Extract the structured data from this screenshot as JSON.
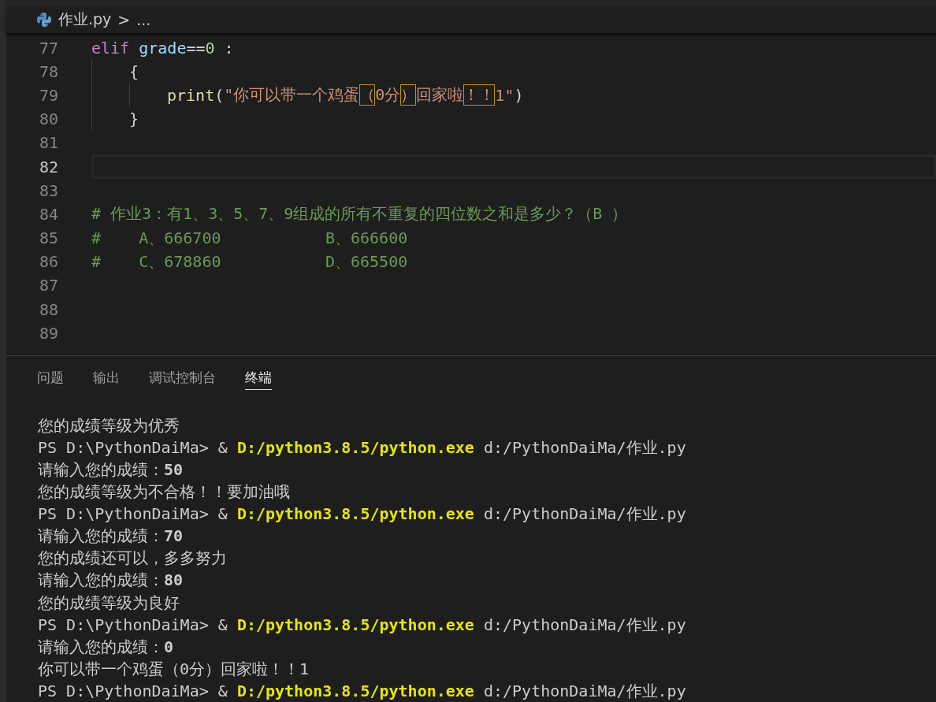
{
  "breadcrumb": {
    "file": "作业.py",
    "separator": ">",
    "more": "..."
  },
  "editor": {
    "lines": [
      {
        "number": "77",
        "current": false,
        "tokens": [
          {
            "kind": "keyword",
            "text": "elif"
          },
          {
            "kind": "variable",
            "text": " grade"
          },
          {
            "kind": "plain",
            "text": "=="
          },
          {
            "kind": "number",
            "text": "0"
          },
          {
            "kind": "plain",
            "text": " :"
          }
        ]
      },
      {
        "number": "78",
        "current": false,
        "tokens": [
          {
            "kind": "indent"
          },
          {
            "kind": "plain",
            "text": "{"
          }
        ]
      },
      {
        "number": "79",
        "current": false,
        "tokens": [
          {
            "kind": "indent"
          },
          {
            "kind": "indent"
          },
          {
            "kind": "function",
            "text": "print"
          },
          {
            "kind": "plain",
            "text": "("
          },
          {
            "kind": "string",
            "text": "\"你可以带一个鸡蛋"
          },
          {
            "kind": "string",
            "text": "（",
            "boxed": true
          },
          {
            "kind": "string",
            "text": "0分"
          },
          {
            "kind": "string",
            "text": "）",
            "boxed": true
          },
          {
            "kind": "string",
            "text": "回家啦"
          },
          {
            "kind": "string",
            "text": "！！",
            "boxed": true
          },
          {
            "kind": "string",
            "text": "1\""
          },
          {
            "kind": "plain",
            "text": ")"
          }
        ]
      },
      {
        "number": "80",
        "current": false,
        "tokens": [
          {
            "kind": "indent"
          },
          {
            "kind": "plain",
            "text": "}"
          }
        ]
      },
      {
        "number": "81",
        "current": false
      },
      {
        "number": "82",
        "current": true
      },
      {
        "number": "83",
        "current": false
      },
      {
        "number": "84",
        "current": false,
        "tokens": [
          {
            "kind": "comment",
            "text": "# 作业3：有1、3、5、7、9组成的所有不重复的四位数之和是多少？（B ）"
          }
        ]
      },
      {
        "number": "85",
        "current": false,
        "tokens": [
          {
            "kind": "comment",
            "text": "#    A、666700           B、666600"
          }
        ]
      },
      {
        "number": "86",
        "current": false,
        "tokens": [
          {
            "kind": "comment",
            "text": "#    C、678860           D、665500"
          }
        ]
      },
      {
        "number": "87",
        "current": false
      },
      {
        "number": "88",
        "current": false
      },
      {
        "number": "89",
        "current": false
      }
    ]
  },
  "panel": {
    "tabs": [
      {
        "label": "问题",
        "selected": false
      },
      {
        "label": "输出",
        "selected": false
      },
      {
        "label": "调试控制台",
        "selected": false
      },
      {
        "label": "终端",
        "selected": true
      }
    ],
    "terminal": [
      {
        "kind": "output",
        "text": "您的成绩等级为优秀"
      },
      {
        "kind": "command",
        "prompt": "PS D:\\PythonDaiMa> &",
        "exe": "D:/python3.8.5/python.exe",
        "arg": "d:/PythonDaiMa/作业.py"
      },
      {
        "kind": "input",
        "text": "请输入您的成绩：",
        "value": "50"
      },
      {
        "kind": "output",
        "text": "您的成绩等级为不合格！！要加油哦"
      },
      {
        "kind": "command",
        "prompt": "PS D:\\PythonDaiMa> &",
        "exe": "D:/python3.8.5/python.exe",
        "arg": "d:/PythonDaiMa/作业.py"
      },
      {
        "kind": "input",
        "text": "请输入您的成绩：",
        "value": "70"
      },
      {
        "kind": "output",
        "text": "您的成绩还可以，多多努力"
      },
      {
        "kind": "input",
        "text": "请输入您的成绩：",
        "value": "80"
      },
      {
        "kind": "output",
        "text": "您的成绩等级为良好"
      },
      {
        "kind": "command",
        "prompt": "PS D:\\PythonDaiMa> &",
        "exe": "D:/python3.8.5/python.exe",
        "arg": "d:/PythonDaiMa/作业.py"
      },
      {
        "kind": "input",
        "text": "请输入您的成绩：",
        "value": "0"
      },
      {
        "kind": "output",
        "text": "你可以带一个鸡蛋（0分）回家啦！！1"
      },
      {
        "kind": "command",
        "prompt": "PS D:\\PythonDaiMa> &",
        "exe": "D:/python3.8.5/python.exe",
        "arg": "d:/PythonDaiMa/作业.py"
      }
    ]
  }
}
